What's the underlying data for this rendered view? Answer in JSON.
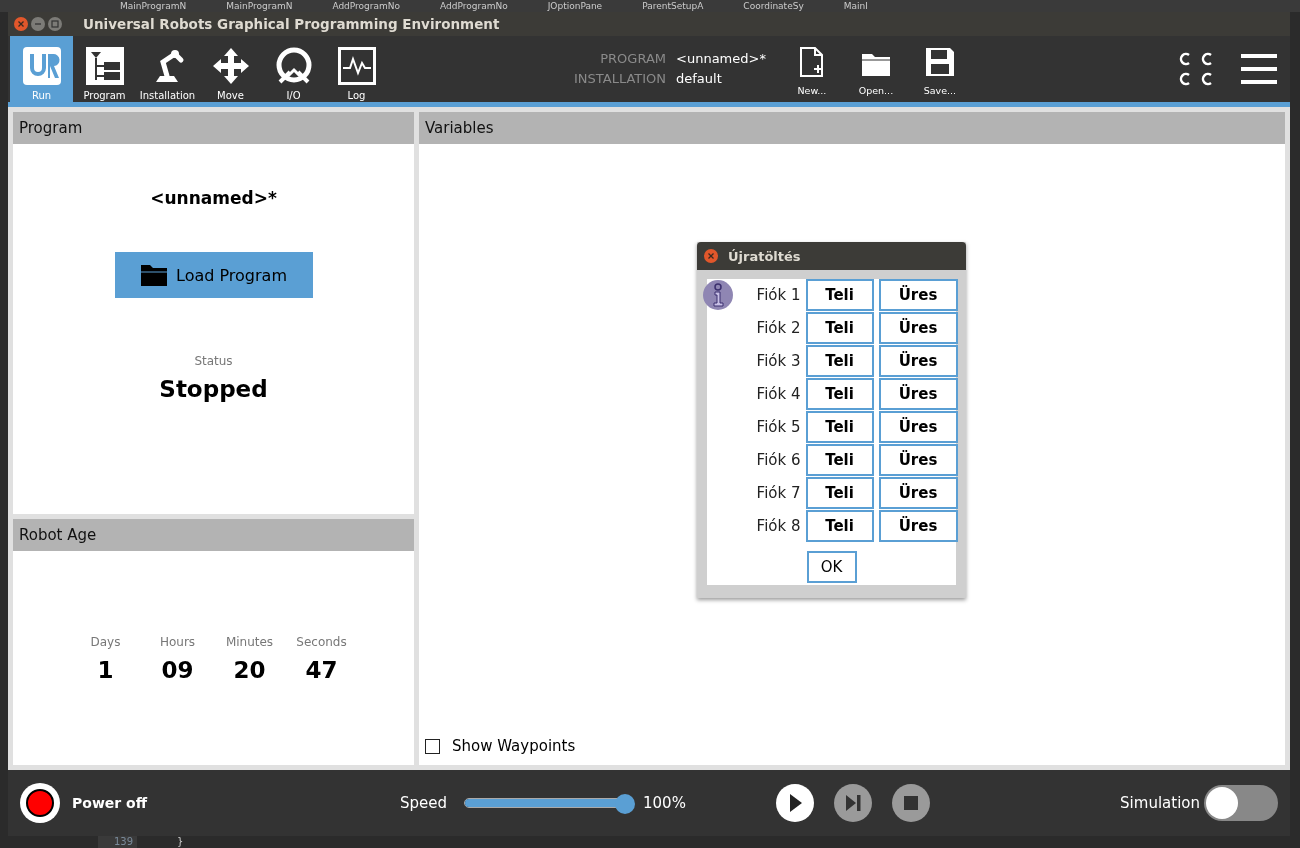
{
  "desktop_tabs": [
    "MainProgramN",
    "MainProgramN",
    "AddProgramNo",
    "AddProgramNo",
    "JOptionPane",
    "ParentSetupA",
    "CoordinateSy",
    "MainI"
  ],
  "desktop_code": {
    "line_number": "139",
    "code": "}"
  },
  "window": {
    "title": "Universal Robots Graphical Programming Environment"
  },
  "nav": [
    {
      "label": "Run",
      "kind": "run",
      "selected": true
    },
    {
      "label": "Program",
      "kind": "program",
      "selected": false
    },
    {
      "label": "Installation",
      "kind": "installation",
      "selected": false
    },
    {
      "label": "Move",
      "kind": "move",
      "selected": false
    },
    {
      "label": "I/O",
      "kind": "io",
      "selected": false
    },
    {
      "label": "Log",
      "kind": "log",
      "selected": false
    }
  ],
  "file_info": [
    {
      "label": "PROGRAM",
      "value": "<unnamed>*"
    },
    {
      "label": "INSTALLATION",
      "value": "default"
    }
  ],
  "file_buttons": [
    {
      "label": "New...",
      "kind": "new"
    },
    {
      "label": "Open...",
      "kind": "open"
    },
    {
      "label": "Save...",
      "kind": "save"
    }
  ],
  "program_panel": {
    "title": "Program",
    "name": "<unnamed>*",
    "load_button": "Load Program",
    "status_label": "Status",
    "status": "Stopped"
  },
  "robot_age": {
    "title": "Robot Age",
    "units": [
      {
        "label": "Days",
        "value": "1"
      },
      {
        "label": "Hours",
        "value": "09"
      },
      {
        "label": "Minutes",
        "value": "20"
      },
      {
        "label": "Seconds",
        "value": "47"
      }
    ]
  },
  "variables": {
    "title": "Variables",
    "show_waypoints": {
      "label": "Show Waypoints",
      "checked": false
    }
  },
  "dialog": {
    "title": "Újratöltés",
    "rows": [
      {
        "label": "Fiók 1",
        "full": "Teli",
        "empty": "Üres"
      },
      {
        "label": "Fiók 2",
        "full": "Teli",
        "empty": "Üres"
      },
      {
        "label": "Fiók 3",
        "full": "Teli",
        "empty": "Üres"
      },
      {
        "label": "Fiók 4",
        "full": "Teli",
        "empty": "Üres"
      },
      {
        "label": "Fiók 5",
        "full": "Teli",
        "empty": "Üres"
      },
      {
        "label": "Fiók 6",
        "full": "Teli",
        "empty": "Üres"
      },
      {
        "label": "Fiók 7",
        "full": "Teli",
        "empty": "Üres"
      },
      {
        "label": "Fiók 8",
        "full": "Teli",
        "empty": "Üres"
      }
    ],
    "ok": "OK"
  },
  "bottom": {
    "power": "Power off",
    "speed_label": "Speed",
    "speed": {
      "level": 1.0
    },
    "speed_reading": "100%",
    "simulation": {
      "label": "Simulation",
      "on": false
    }
  }
}
